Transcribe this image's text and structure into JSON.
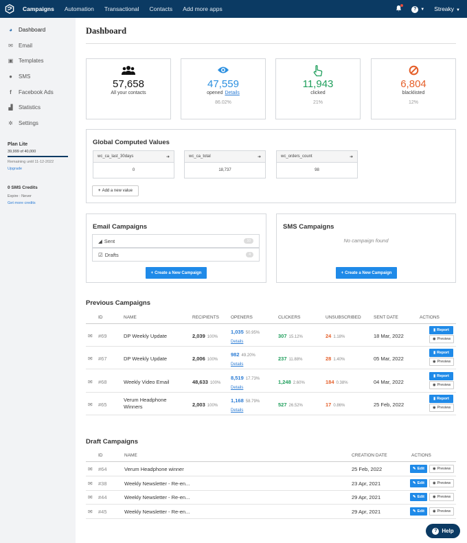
{
  "topnav": {
    "items": [
      {
        "label": "Campaigns",
        "active": true
      },
      {
        "label": "Automation"
      },
      {
        "label": "Transactional"
      },
      {
        "label": "Contacts"
      },
      {
        "label": "Add more apps"
      }
    ],
    "user": "Streaky",
    "help_glyph": "?"
  },
  "sidebar": {
    "items": [
      {
        "label": "Dashboard",
        "icon": "dashboard-icon"
      },
      {
        "label": "Email",
        "icon": "envelope-icon"
      },
      {
        "label": "Templates",
        "icon": "templates-icon"
      },
      {
        "label": "SMS",
        "icon": "sms-icon"
      },
      {
        "label": "Facebook Ads",
        "icon": "facebook-icon"
      },
      {
        "label": "Statistics",
        "icon": "statistics-icon"
      },
      {
        "label": "Settings",
        "icon": "gear-icon"
      }
    ],
    "plan": {
      "title": "Plan Lite",
      "count": "39,999 of 40,000",
      "remaining": "Remaining until 11-12-2022",
      "upgrade": "Upgrade"
    },
    "sms": {
      "title": "0 SMS Credits",
      "expire": "Expire : Never",
      "link": "Get more credits"
    }
  },
  "page": {
    "title": "Dashboard"
  },
  "stats": [
    {
      "value": "57,658",
      "label": "All your contacts",
      "pct": "",
      "color": "#111111"
    },
    {
      "value": "47,559",
      "label": "opened",
      "link": "Details",
      "pct": "86.02%",
      "color": "#2a8fe0"
    },
    {
      "value": "11,943",
      "label": "clicked",
      "pct": "21%",
      "color": "#1e9e5b"
    },
    {
      "value": "6,804",
      "label": "blacklisted",
      "pct": "12%",
      "color": "#e5602b"
    }
  ],
  "gcv": {
    "title": "Global Computed Values",
    "boxes": [
      {
        "name": "wc_ca_last_30days",
        "value": "0"
      },
      {
        "name": "wc_ca_total",
        "value": "18,737"
      },
      {
        "name": "wc_orders_count",
        "value": "98"
      }
    ],
    "add_label": "Add a new value"
  },
  "email_campaigns": {
    "title": "Email Campaigns",
    "rows": [
      {
        "label": "Sent",
        "count": "10"
      },
      {
        "label": "Drafts",
        "count": "4"
      }
    ],
    "button": "Create a New Campaign"
  },
  "sms_campaigns": {
    "title": "SMS Campaigns",
    "empty": "No campaign found",
    "button": "Create a New Campaign"
  },
  "previous": {
    "title": "Previous Campaigns",
    "headers": {
      "id": "ID",
      "name": "NAME",
      "recipients": "RECIPIENTS",
      "openers": "OPENERS",
      "clickers": "CLICKERS",
      "unsubscribed": "UNSUBSCRIBED",
      "sent_date": "SENT DATE",
      "actions": "ACTIONS"
    },
    "details_label": "Details",
    "report_label": "Report",
    "preview_label": "Preview",
    "rows": [
      {
        "id": "#69",
        "name": "DP Weekly Update",
        "recipients": "2,039",
        "recipients_pct": "100%",
        "openers": "1,035",
        "openers_pct": "50.95%",
        "clickers": "307",
        "clickers_pct": "15.12%",
        "unsub": "24",
        "unsub_pct": "1.18%",
        "date": "18 Mar, 2022"
      },
      {
        "id": "#67",
        "name": "DP Weekly Update",
        "recipients": "2,006",
        "recipients_pct": "100%",
        "openers": "982",
        "openers_pct": "49.20%",
        "clickers": "237",
        "clickers_pct": "11.88%",
        "unsub": "28",
        "unsub_pct": "1.40%",
        "date": "05 Mar, 2022"
      },
      {
        "id": "#68",
        "name": "Weekly Video Email",
        "recipients": "48,633",
        "recipients_pct": "100%",
        "openers": "8,519",
        "openers_pct": "17.73%",
        "clickers": "1,248",
        "clickers_pct": "2.60%",
        "unsub": "184",
        "unsub_pct": "0.38%",
        "date": "04 Mar, 2022"
      },
      {
        "id": "#65",
        "name": "Verum Headphone Winners",
        "recipients": "2,003",
        "recipients_pct": "100%",
        "openers": "1,168",
        "openers_pct": "58.79%",
        "clickers": "527",
        "clickers_pct": "26.52%",
        "unsub": "17",
        "unsub_pct": "0.86%",
        "date": "25 Feb, 2022"
      }
    ]
  },
  "drafts": {
    "title": "Draft Campaigns",
    "headers": {
      "id": "ID",
      "name": "NAME",
      "created": "CREATION DATE",
      "actions": "ACTIONS"
    },
    "edit_label": "Edit",
    "preview_label": "Preview",
    "rows": [
      {
        "id": "#64",
        "name": "Verum Headphone winner",
        "date": "25 Feb, 2022"
      },
      {
        "id": "#38",
        "name": "Weekly Newsletter - Re-en...",
        "date": "23 Apr, 2021"
      },
      {
        "id": "#44",
        "name": "Weekly Newsletter - Re-en...",
        "date": "29 Apr, 2021"
      },
      {
        "id": "#45",
        "name": "Weekly Newsletter - Re-en...",
        "date": "29 Apr, 2021"
      }
    ]
  },
  "help": {
    "label": "Help"
  }
}
